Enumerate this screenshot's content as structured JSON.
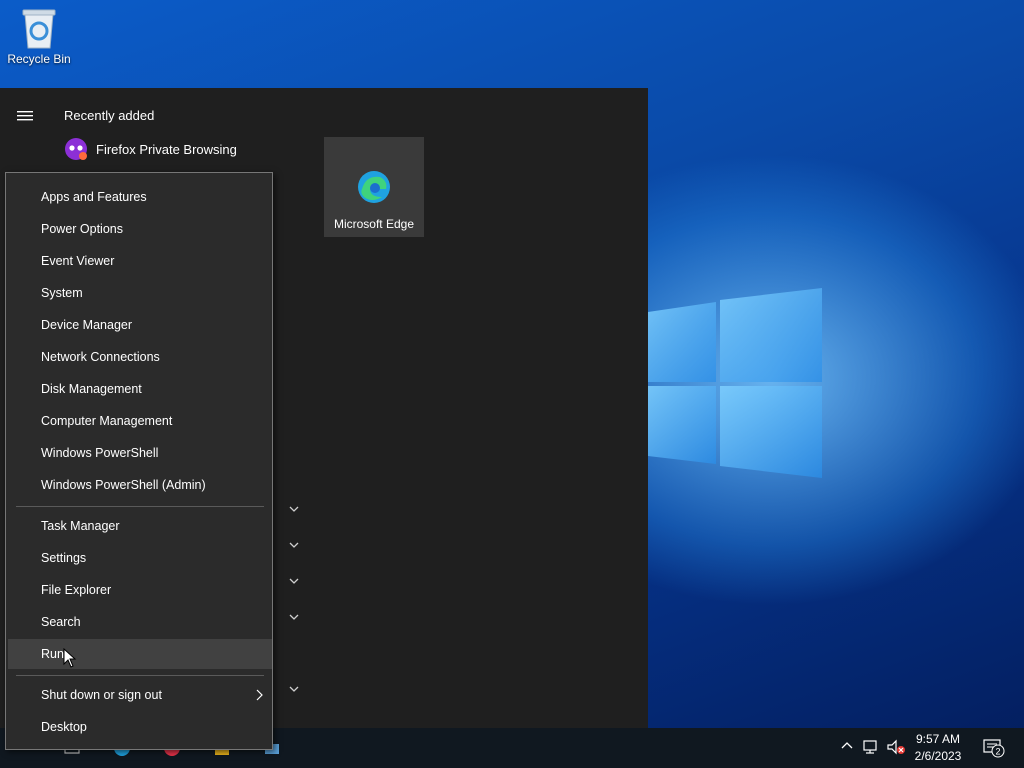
{
  "desktop": {
    "icons": [
      {
        "label": "Recycle Bin",
        "icon": "recycle-bin-icon"
      }
    ]
  },
  "start_menu": {
    "section_label": "Recently added",
    "recent_apps": [
      {
        "label": "Firefox Private Browsing",
        "icon": "firefox-private-icon"
      }
    ],
    "tiles": [
      {
        "label": "Microsoft Edge",
        "icon": "edge-icon"
      }
    ]
  },
  "context_menu": {
    "groups": [
      [
        "Apps and Features",
        "Power Options",
        "Event Viewer",
        "System",
        "Device Manager",
        "Network Connections",
        "Disk Management",
        "Computer Management",
        "Windows PowerShell",
        "Windows PowerShell (Admin)"
      ],
      [
        "Task Manager",
        "Settings",
        "File Explorer",
        "Search",
        "Run"
      ],
      [
        "Shut down or sign out",
        "Desktop"
      ]
    ],
    "hovered_item": "Run",
    "submenu_item": "Shut down or sign out"
  },
  "taskbar": {
    "clock_time": "9:57 AM",
    "clock_date": "2/6/2023",
    "notification_count": "2"
  },
  "colors": {
    "menu_bg": "#2b2b2b",
    "start_bg": "#1f1f1f",
    "hover_bg": "#414141",
    "accent": "#0078d7"
  }
}
